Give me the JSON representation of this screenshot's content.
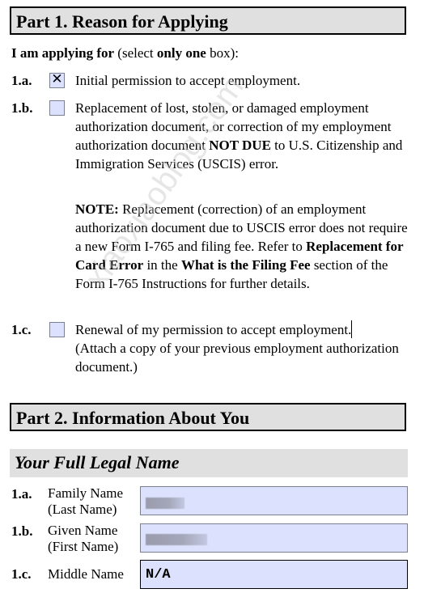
{
  "part1": {
    "title": "Part 1.  Reason for Applying",
    "intro": {
      "bold1": "I am applying for",
      "normal1": " (select ",
      "bold2": "only one",
      "normal2": " box):"
    },
    "options": [
      {
        "number": "1.a.",
        "checked": true,
        "check_mark": "✕",
        "text": "Initial permission to accept employment."
      },
      {
        "number": "1.b.",
        "checked": false,
        "text_part1": "Replacement of lost, stolen, or damaged employment authorization document, or correction of my employment authorization document ",
        "text_bold": "NOT DUE",
        "text_part2": " to U.S. Citizenship and Immigration Services (USCIS) error."
      },
      {
        "number": "1.c.",
        "checked": false,
        "text_line1": "Renewal of my permission to accept employment.",
        "text_line2": "(Attach a copy of your previous employment authorization document.)"
      }
    ],
    "note": {
      "label": "NOTE:",
      "t1": "  Replacement (correction) of an employment authorization document due to USCIS error does not require a new Form I-765 and filing fee.  Refer to ",
      "b1": "Replacement for Card Error",
      "t2": " in the ",
      "b2": "What is the Filing Fee",
      "t3": " section of the Form I-765 Instructions for further details."
    }
  },
  "part2": {
    "title": "Part 2.  Information About You",
    "subsection": "Your Full Legal Name",
    "fields": [
      {
        "number": "1.a.",
        "label_line1": "Family Name",
        "label_line2": "(Last Name)",
        "value": "",
        "redacted": true
      },
      {
        "number": "1.b.",
        "label_line1": "Given Name",
        "label_line2": "(First Name)",
        "value": "",
        "redacted": true
      },
      {
        "number": "1.c.",
        "label_line1": "Middle Name",
        "label_line2": "",
        "value": "N/A",
        "redacted": false
      }
    ]
  },
  "watermark": "xiaoxiaoblog.com",
  "colors": {
    "field_bg": "#dce2fd",
    "header_bg": "#e0e0e0"
  }
}
